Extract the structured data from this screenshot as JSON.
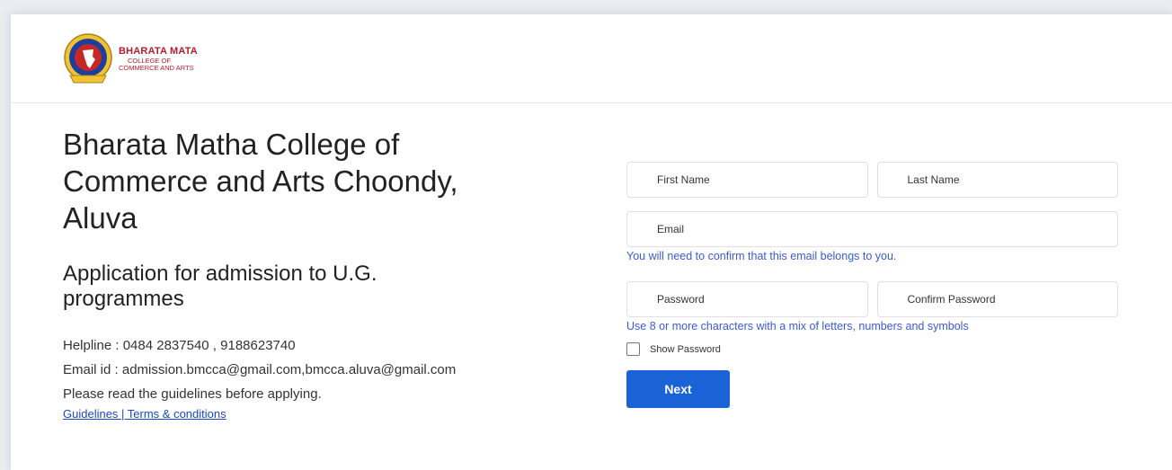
{
  "logo": {
    "line1": "BHARATA MATA",
    "line2": "COLLEGE OF",
    "line3": "COMMERCE AND ARTS"
  },
  "college": {
    "title": "Bharata Matha College of Commerce and Arts Choondy, Aluva",
    "application_title": "Application for admission to U.G. programmes",
    "helpline": "Helpline : 0484 2837540 , 9188623740",
    "email": "Email id : admission.bmcca@gmail.com,bmcca.aluva@gmail.com",
    "notice": "Please read the guidelines before applying.",
    "guidelines_link": "Guidelines | Terms & conditions"
  },
  "form": {
    "first_name_placeholder": "First Name",
    "last_name_placeholder": "Last Name",
    "email_placeholder": "Email",
    "email_hint": "You will need to confirm that this email belongs to you.",
    "password_placeholder": "Password",
    "confirm_password_placeholder": "Confirm Password",
    "password_hint": "Use 8 or more characters with a mix of letters, numbers and symbols",
    "show_password_label": "Show Password",
    "next_label": "Next"
  },
  "colors": {
    "brand_red": "#b71c2a",
    "link_blue": "#1a48c4",
    "button_blue": "#1a63d6"
  }
}
